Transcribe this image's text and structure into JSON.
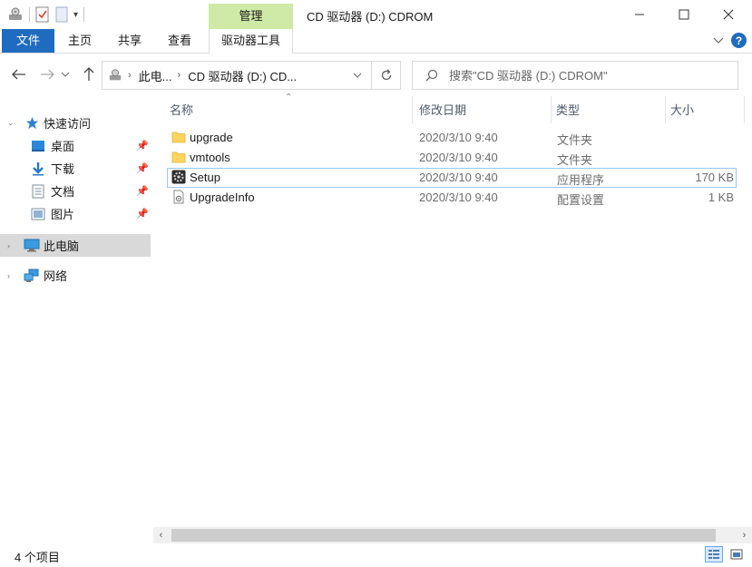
{
  "window": {
    "title": "CD 驱动器 (D:) CDROM",
    "context_group": "管理",
    "controls": {
      "minimize": "—",
      "maximize": "☐",
      "close": "✕"
    }
  },
  "ribbon": {
    "tabs": [
      "文件",
      "主页",
      "共享",
      "查看"
    ],
    "context_tab": "驱动器工具",
    "expand_icon": "chevron-down-icon",
    "help": "?"
  },
  "address": {
    "crumbs": [
      "此电...",
      "CD 驱动器 (D:) CD..."
    ],
    "search_placeholder": "搜索\"CD 驱动器 (D:) CDROM\""
  },
  "nav": {
    "quick_access": "快速访问",
    "pinned": [
      "桌面",
      "下载",
      "文档",
      "图片"
    ],
    "this_pc": "此电脑",
    "network": "网络"
  },
  "columns": {
    "name": "名称",
    "date": "修改日期",
    "type": "类型",
    "size": "大小"
  },
  "files": [
    {
      "name": "upgrade",
      "date": "2020/3/10 9:40",
      "type": "文件夹",
      "size": "",
      "icon": "folder-icon"
    },
    {
      "name": "vmtools",
      "date": "2020/3/10 9:40",
      "type": "文件夹",
      "size": "",
      "icon": "folder-icon"
    },
    {
      "name": "Setup",
      "date": "2020/3/10 9:40",
      "type": "应用程序",
      "size": "170 KB",
      "icon": "setup-app-icon"
    },
    {
      "name": "UpgradeInfo",
      "date": "2020/3/10 9:40",
      "type": "配置设置",
      "size": "1 KB",
      "icon": "config-file-icon"
    }
  ],
  "status": {
    "item_count": "4 个项目"
  },
  "colors": {
    "accent": "#1f6bc0",
    "context_tab": "#cfe9a6",
    "selected_nav": "#d9d9d9",
    "folder": "#ffd45c"
  }
}
